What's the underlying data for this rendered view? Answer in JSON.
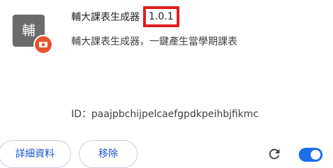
{
  "extension": {
    "icon_text": "輔",
    "name": "輔大課表生成器",
    "version": "1.0.1",
    "description": "輔大課表生成器，一鍵產生當學期課表",
    "id_text": "ID：paajpbchijpelcaefgpdkpeihbjfikmc",
    "enabled": true
  },
  "actions": {
    "details_label": "詳細資料",
    "remove_label": "移除"
  },
  "icons": {
    "badge": "extension-badge-icon",
    "reload": "reload-icon"
  },
  "colors": {
    "accent": "#1a6ee8",
    "badge": "#e8542c",
    "highlight": "#e01e1e"
  }
}
